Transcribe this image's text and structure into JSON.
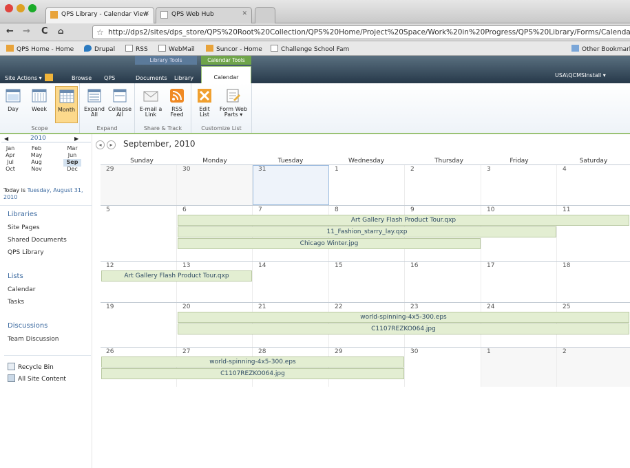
{
  "browser": {
    "tabs": [
      {
        "label": "QPS Library - Calendar View"
      },
      {
        "label": "QPS Web Hub"
      }
    ],
    "url": "http://dps2/sites/dps_store/QPS%20Root%20Collection/QPS%20Home/Project%20Space/Work%20in%20Progress/QPS%20Library/Forms/Calendar%",
    "bookmarks": [
      "QPS Home - Home",
      "Drupal",
      "RSS",
      "WebMail",
      "Suncor - Home",
      "Challenge School Fam",
      "Other Bookmarks"
    ]
  },
  "ribbon": {
    "site_actions": "Site Actions",
    "tabs": [
      "Browse",
      "QPS",
      "Documents",
      "Library",
      "Calendar"
    ],
    "context_library": "Library Tools",
    "context_calendar": "Calendar Tools",
    "user": "USA\\QCMSInstall",
    "groups": [
      "Scope",
      "Expand",
      "Share & Track",
      "Customize List"
    ],
    "buttons": [
      "Day",
      "Week",
      "Month",
      "Expand All",
      "Collapse All",
      "E-mail a Link",
      "RSS Feed",
      "Edit List",
      "Form Web Parts"
    ]
  },
  "datenav": {
    "year": "2010",
    "months": [
      "Jan",
      "Feb",
      "Mar",
      "Apr",
      "May",
      "Jun",
      "Jul",
      "Aug",
      "Sep",
      "Oct",
      "Nov",
      "Dec"
    ],
    "selected": "Sep",
    "today_prefix": "Today is ",
    "today_date": "Tuesday, August 31, 2010"
  },
  "leftnav": {
    "libraries_header": "Libraries",
    "libraries": [
      "Site Pages",
      "Shared Documents",
      "QPS Library"
    ],
    "lists_header": "Lists",
    "lists": [
      "Calendar",
      "Tasks"
    ],
    "discussions_header": "Discussions",
    "discussions": [
      "Team Discussion"
    ],
    "recycle": "Recycle Bin",
    "all_content": "All Site Content"
  },
  "calendar": {
    "title": "September, 2010",
    "days": [
      "Sunday",
      "Monday",
      "Tuesday",
      "Wednesday",
      "Thursday",
      "Friday",
      "Saturday"
    ],
    "weeks": [
      [
        "29",
        "30",
        "31",
        "1",
        "2",
        "3",
        "4"
      ],
      [
        "5",
        "6",
        "7",
        "8",
        "9",
        "10",
        "11"
      ],
      [
        "12",
        "13",
        "14",
        "15",
        "16",
        "17",
        "18"
      ],
      [
        "19",
        "20",
        "21",
        "22",
        "23",
        "24",
        "25"
      ],
      [
        "26",
        "27",
        "28",
        "29",
        "30",
        "1",
        "2"
      ]
    ],
    "events": [
      "Art Gallery Flash Product Tour.qxp",
      "11_Fashion_starry_lay.qxp",
      "Chicago Winter.jpg",
      "Art Gallery Flash Product Tour.qxp",
      "world-spinning-4x5-300.eps",
      "C1107REZKO064.jpg",
      "world-spinning-4x5-300.eps",
      "C1107REZKO064.jpg"
    ]
  }
}
